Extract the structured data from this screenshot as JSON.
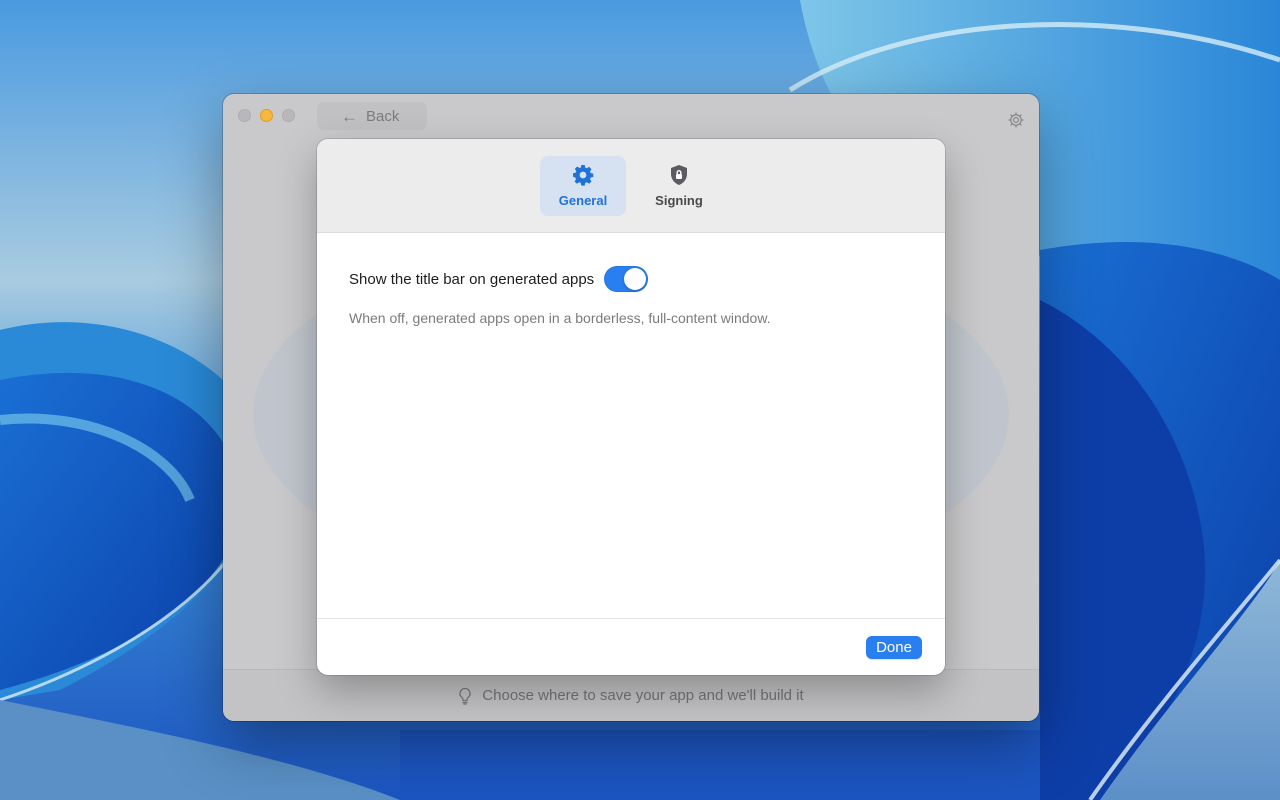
{
  "window": {
    "back_label": "Back",
    "footer_hint": "Choose where to save your app and we'll build it"
  },
  "preferences": {
    "tabs": [
      {
        "label": "General",
        "icon": "gear-icon",
        "active": true
      },
      {
        "label": "Signing",
        "icon": "shield-lock-icon",
        "active": false
      }
    ],
    "setting": {
      "label": "Show the title bar on generated apps",
      "enabled": true,
      "description": "When off, generated apps open in a borderless, full-content window."
    },
    "done_label": "Done"
  },
  "colors": {
    "accent": "#2a7ff0",
    "active_tab_bg": "#d6e2f1",
    "traffic_yellow": "#f6b73a"
  }
}
